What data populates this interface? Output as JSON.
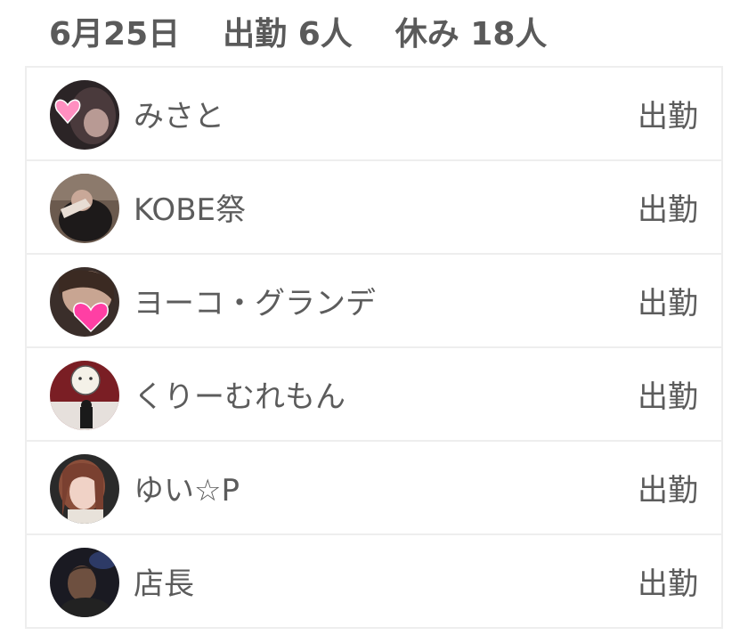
{
  "header": {
    "date": "6月25日",
    "attending": "出勤 6人",
    "off": "休み 18人"
  },
  "staff": [
    {
      "name": "みさと",
      "status": "出勤",
      "avatar": "photo-with-pink-heart-sticker"
    },
    {
      "name": "KOBE祭",
      "status": "出勤",
      "avatar": "photo-person-in-dark-clothes"
    },
    {
      "name": "ヨーコ・グランデ",
      "status": "出勤",
      "avatar": "photo-with-pink-heart-sticker"
    },
    {
      "name": "くりーむれもん",
      "status": "出勤",
      "avatar": "photo-character-mascot"
    },
    {
      "name": "ゆい☆P",
      "status": "出勤",
      "avatar": "photo-woman-with-hair"
    },
    {
      "name": "店長",
      "status": "出勤",
      "avatar": "photo-man-in-dark"
    }
  ]
}
